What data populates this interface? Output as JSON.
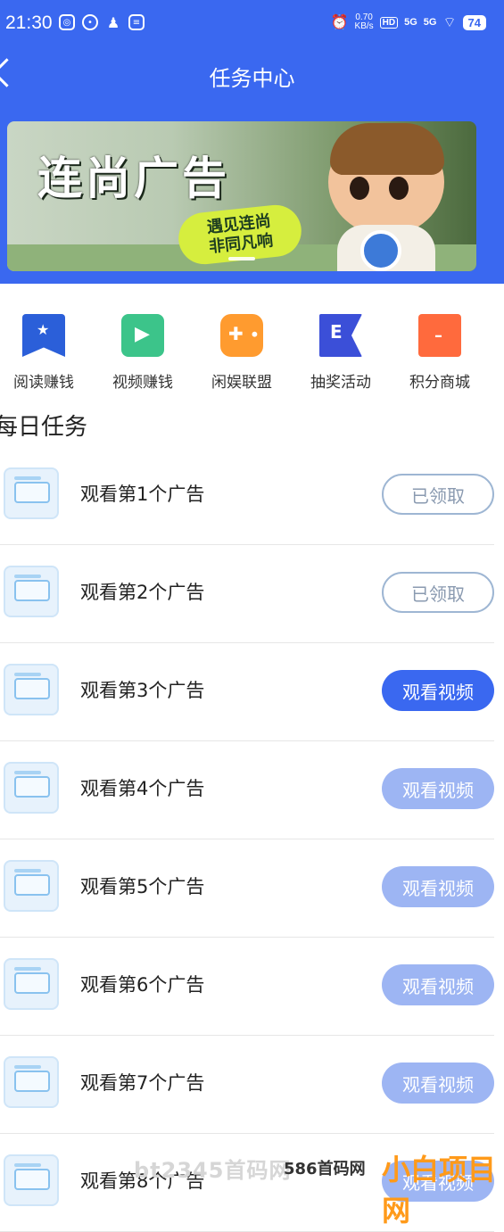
{
  "status_bar": {
    "time": "21:30",
    "speed_value": "0.70",
    "speed_unit": "KB/s",
    "hd": "HD",
    "signal1": "5G",
    "signal2": "5G",
    "battery": "74"
  },
  "nav": {
    "title": "任务中心"
  },
  "banner": {
    "title": "连尚广告",
    "tagline_line1": "遇见连尚",
    "tagline_line2": "非同凡响"
  },
  "categories": [
    {
      "label": "阅读赚钱",
      "icon": "bookmark-star-icon",
      "color": "#2b5fd9"
    },
    {
      "label": "视频赚钱",
      "icon": "video-play-icon",
      "color": "#3cc48a"
    },
    {
      "label": "闲娱联盟",
      "icon": "gamepad-icon",
      "color": "#ff9b2f"
    },
    {
      "label": "抽奖活动",
      "icon": "flag-list-icon",
      "color": "#3b4fd8"
    },
    {
      "label": "积分商城",
      "icon": "gift-box-icon",
      "color": "#ff6a3d"
    }
  ],
  "section_title": "每日任务",
  "tasks": [
    {
      "title": "观看第1个广告",
      "button": "已领取",
      "state": "claimed"
    },
    {
      "title": "观看第2个广告",
      "button": "已领取",
      "state": "claimed"
    },
    {
      "title": "观看第3个广告",
      "button": "观看视频",
      "state": "active"
    },
    {
      "title": "观看第4个广告",
      "button": "观看视频",
      "state": "disabled"
    },
    {
      "title": "观看第5个广告",
      "button": "观看视频",
      "state": "disabled"
    },
    {
      "title": "观看第6个广告",
      "button": "观看视频",
      "state": "disabled"
    },
    {
      "title": "观看第7个广告",
      "button": "观看视频",
      "state": "disabled"
    },
    {
      "title": "观看第8个广告",
      "button": "观看视频",
      "state": "disabled"
    }
  ],
  "watermark": {
    "text1": "bt2345首码网",
    "text2": "586首码网",
    "text3": "小白项目网"
  }
}
